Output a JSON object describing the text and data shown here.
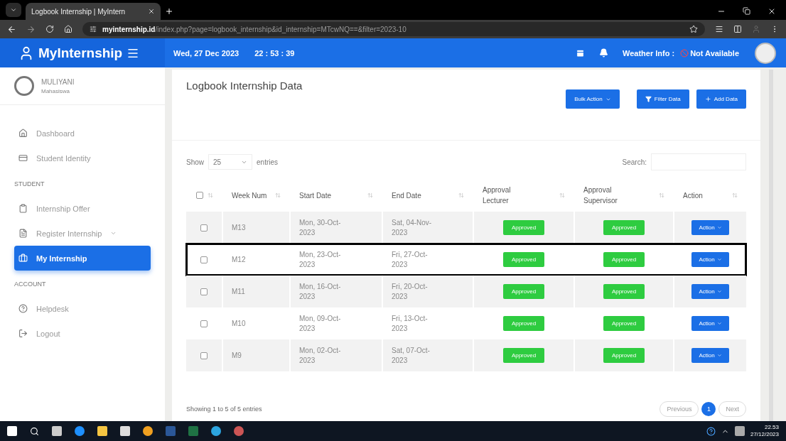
{
  "browser": {
    "tabs": [
      {
        "title": "Logbook Internship | MyIntern",
        "selected": true
      }
    ],
    "url": {
      "domain": "myinternship.id",
      "path": "/index.php?page=logbook_internship&id_internship=MTcwNQ==&filter=2023-10"
    }
  },
  "header": {
    "logo": "MyInternship",
    "date": "Wed, 27 Dec 2023",
    "time": "22 : 53 : 39",
    "weather_label": "Weather Info :",
    "weather_value": "Not Available"
  },
  "sidebar": {
    "user": {
      "name": "MULIYANI",
      "role": "Mahasiswa"
    },
    "sections": [
      {
        "items": [
          {
            "label": "Dashboard",
            "selected": false
          },
          {
            "label": "Student Identity",
            "selected": false
          }
        ]
      },
      {
        "heading": "STUDENT",
        "items": [
          {
            "label": "Internship Offer",
            "selected": false
          },
          {
            "label": "Register Internship",
            "selected": false,
            "has_submenu": true
          },
          {
            "label": "My Internship",
            "selected": true
          }
        ]
      },
      {
        "heading": "ACCOUNT",
        "items": [
          {
            "label": "Helpdesk",
            "selected": false
          },
          {
            "label": "Logout",
            "selected": false
          }
        ]
      }
    ]
  },
  "page": {
    "title": "Logbook Internship Data",
    "buttons": [
      {
        "label": "Bulk Action",
        "kind": "dropdown"
      },
      {
        "label": "Filter Data",
        "kind": "filter"
      },
      {
        "label": "Add Data",
        "kind": "add"
      }
    ],
    "show_label": "Show",
    "page_length": "25",
    "entries_label": "entries",
    "search_label": "Search:",
    "table": {
      "header_checked": false,
      "columns": [
        {
          "label": "Week Num"
        },
        {
          "label": "Start Date"
        },
        {
          "label": "End Date"
        },
        {
          "label": "Approval Lecturer"
        },
        {
          "label": "Approval Supervisor"
        },
        {
          "label": "Action"
        }
      ],
      "rows": [
        {
          "checked": false,
          "highlighted": false,
          "week": "M13",
          "start": "Mon, 30-Oct-2023",
          "end": "Sat, 04-Nov-2023",
          "lecturer": "Approved",
          "supervisor": "Approved",
          "action": "Action"
        },
        {
          "checked": false,
          "highlighted": true,
          "week": "M12",
          "start": "Mon, 23-Oct-2023",
          "end": "Fri, 27-Oct-2023",
          "lecturer": "Approved",
          "supervisor": "Approved",
          "action": "Action"
        },
        {
          "checked": false,
          "highlighted": false,
          "week": "M11",
          "start": "Mon, 16-Oct-2023",
          "end": "Fri, 20-Oct-2023",
          "lecturer": "Approved",
          "supervisor": "Approved",
          "action": "Action"
        },
        {
          "checked": false,
          "highlighted": false,
          "week": "M10",
          "start": "Mon, 09-Oct-2023",
          "end": "Fri, 13-Oct-2023",
          "lecturer": "Approved",
          "supervisor": "Approved",
          "action": "Action"
        },
        {
          "checked": false,
          "highlighted": false,
          "week": "M9",
          "start": "Mon, 02-Oct-2023",
          "end": "Sat, 07-Oct-2023",
          "lecturer": "Approved",
          "supervisor": "Approved",
          "action": "Action"
        }
      ]
    },
    "info": "Showing 1 to 5 of 5 entries",
    "pagination": {
      "previous": "Previous",
      "pages": [
        {
          "label": "1",
          "selected": true
        }
      ],
      "next": "Next"
    }
  },
  "taskbar": {
    "time": "22.53",
    "date": "27/12/2023"
  }
}
